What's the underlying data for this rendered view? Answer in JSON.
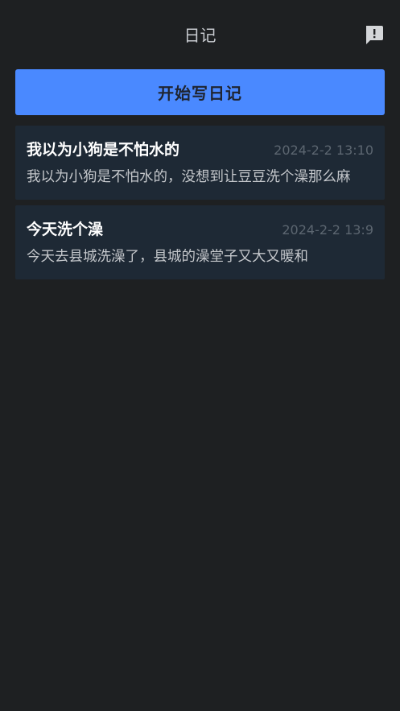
{
  "header": {
    "title": "日记",
    "feedback_icon": "feedback-exclamation-icon"
  },
  "actions": {
    "write_label": "开始写日记"
  },
  "entries": [
    {
      "title": "我以为小狗是不怕水的",
      "time": "2024-2-2 13:10",
      "preview": "我以为小狗是不怕水的，没想到让豆豆洗个澡那么麻"
    },
    {
      "title": "今天洗个澡",
      "time": "2024-2-2 13:9",
      "preview": "今天去县城洗澡了，县城的澡堂子又大又暖和"
    }
  ],
  "colors": {
    "background": "#1e2022",
    "accent": "#4a89ff",
    "card": "#1e2935"
  }
}
